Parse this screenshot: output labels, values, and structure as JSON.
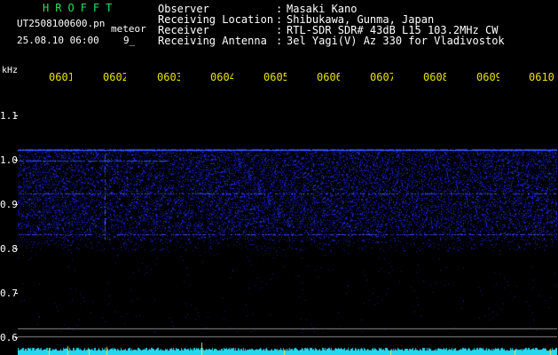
{
  "header": {
    "program": "HROFFT",
    "filename": "UT2508100600.pn",
    "meteor_tag": "meteor",
    "datetime": "25.08.10 06:00",
    "small_field": "9_"
  },
  "info": [
    {
      "key": "Observer",
      "value": "Masaki Kano"
    },
    {
      "key": "Receiving Location",
      "value": "Shibukawa, Gunma, Japan"
    },
    {
      "key": "Receiver",
      "value": "RTL-SDR SDR# 43dB L15 103.2MHz CW"
    },
    {
      "key": "Receiving Antenna",
      "value": "3el Yagi(V) Az 330 for Vladivostok"
    }
  ],
  "axis": {
    "unit": "kHz",
    "y_labels": [
      "1.1",
      "1.0",
      "0.9",
      "0.8",
      "0.7",
      "0.6"
    ],
    "time_labels": [
      "0601",
      "0602",
      "0603",
      "0604",
      "0605",
      "0606",
      "0607",
      "0608",
      "0609",
      "0610"
    ]
  },
  "colors": {
    "title_green": "#22e05a",
    "time_yellow": "#e8e000",
    "signal_blue": "#2a3cff",
    "signal_band": "#5070ff",
    "baseline_cyan": "#25d8f0",
    "ref_line": "#888888"
  }
}
